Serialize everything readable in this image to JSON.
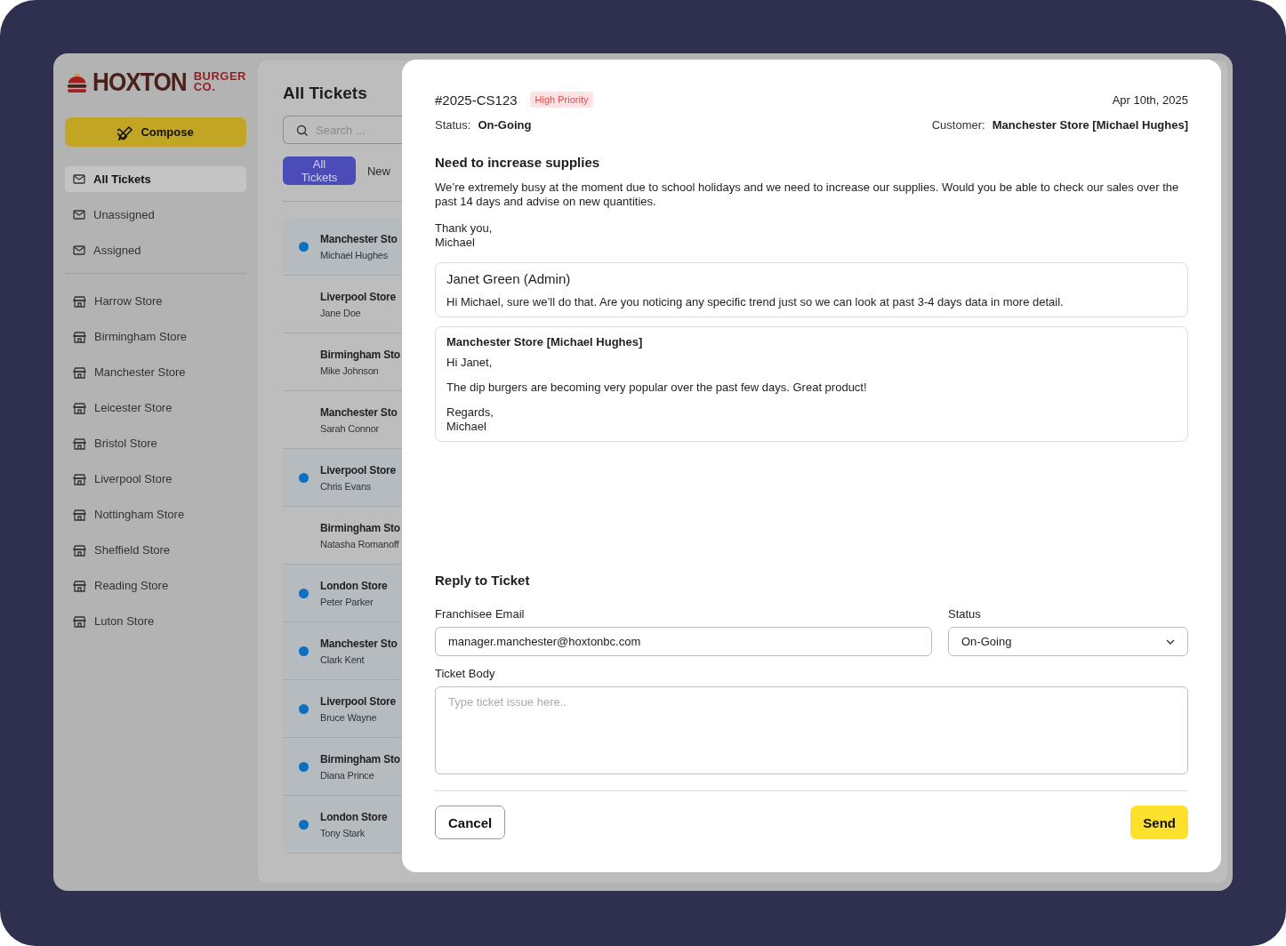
{
  "logo": {
    "name": "HOXTON",
    "tagline_top": "BURGER",
    "tagline_bottom": "CO."
  },
  "compose_button": "Compose",
  "mailboxes": [
    {
      "label": "All Tickets",
      "selected": true
    },
    {
      "label": "Unassigned",
      "selected": false
    },
    {
      "label": "Assigned",
      "selected": false
    }
  ],
  "stores": [
    {
      "label": "Harrow Store",
      "selected": false
    },
    {
      "label": "Birmingham Store",
      "selected": false
    },
    {
      "label": "Manchester Store",
      "selected": false
    },
    {
      "label": "Leicester Store",
      "selected": false
    },
    {
      "label": "Bristol Store",
      "selected": false
    },
    {
      "label": "Liverpool Store",
      "selected": false
    },
    {
      "label": "Nottingham Store",
      "selected": false
    },
    {
      "label": "Sheffield Store",
      "selected": false
    },
    {
      "label": "Reading Store",
      "selected": false
    },
    {
      "label": "Luton Store",
      "selected": false
    }
  ],
  "ticket_list": {
    "title": "All Tickets",
    "search": {
      "placeholder": "Search ..."
    },
    "tabs": [
      {
        "label": "All Tickets",
        "selected": true
      },
      {
        "label": "New",
        "selected": false
      }
    ],
    "tickets": [
      {
        "store": "Manchester Sto",
        "contact": "Michael Hughes",
        "unread": true
      },
      {
        "store": "Liverpool Store",
        "contact": "Jane Doe",
        "unread": false
      },
      {
        "store": "Birmingham Sto",
        "contact": "Mike Johnson",
        "unread": false
      },
      {
        "store": "Manchester Sto",
        "contact": "Sarah Connor",
        "unread": false
      },
      {
        "store": "Liverpool Store",
        "contact": "Chris Evans",
        "unread": true
      },
      {
        "store": "Birmingham Sto",
        "contact": "Natasha Romanoff",
        "unread": false
      },
      {
        "store": "London Store",
        "contact": "Peter Parker",
        "unread": true
      },
      {
        "store": "Manchester Sto",
        "contact": "Clark Kent",
        "unread": true
      },
      {
        "store": "Liverpool Store",
        "contact": "Bruce Wayne",
        "unread": true
      },
      {
        "store": "Birmingham Sto",
        "contact": "Diana Prince",
        "unread": true
      },
      {
        "store": "London Store",
        "contact": "Tony Stark",
        "unread": true
      }
    ]
  },
  "ticket": {
    "number": "#2025-CS123",
    "priority": "High Priority",
    "date": "Apr 10th, 2025",
    "status_label": "Status:",
    "status": "On-Going",
    "customer_label": "Customer:",
    "customer": "Manchester Store [Michael Hughes]",
    "subject": "Need to increase supplies",
    "body": [
      "We’re extremely busy at the moment due to school holidays and we need to increase our supplies. Would you be able to check our sales over the past 14 days and advise on new quantities.",
      "Thank you,\nMichael"
    ],
    "replies": [
      {
        "kind": "admin",
        "author": "Janet Green (Admin)",
        "paragraphs": [
          "Hi Michael, sure we’ll do that. Are you noticing any specific trend just so we can look at past 3-4 days data in more detail."
        ]
      },
      {
        "kind": "customer",
        "author": "Manchester Store [Michael Hughes]",
        "paragraphs": [
          "Hi Janet,",
          "The dip burgers are becoming very popular over the past few days. Great product!",
          "Regards,\nMichael"
        ]
      }
    ]
  },
  "reply_form": {
    "title": "Reply to Ticket",
    "email_label": "Franchisee Email",
    "email": "manager.manchester@hoxtonbc.com",
    "status_label": "Status",
    "status": "On-Going",
    "body_label": "Ticket Body",
    "body_placeholder": "Type ticket issue here..",
    "cancel": "Cancel",
    "send": "Send"
  }
}
